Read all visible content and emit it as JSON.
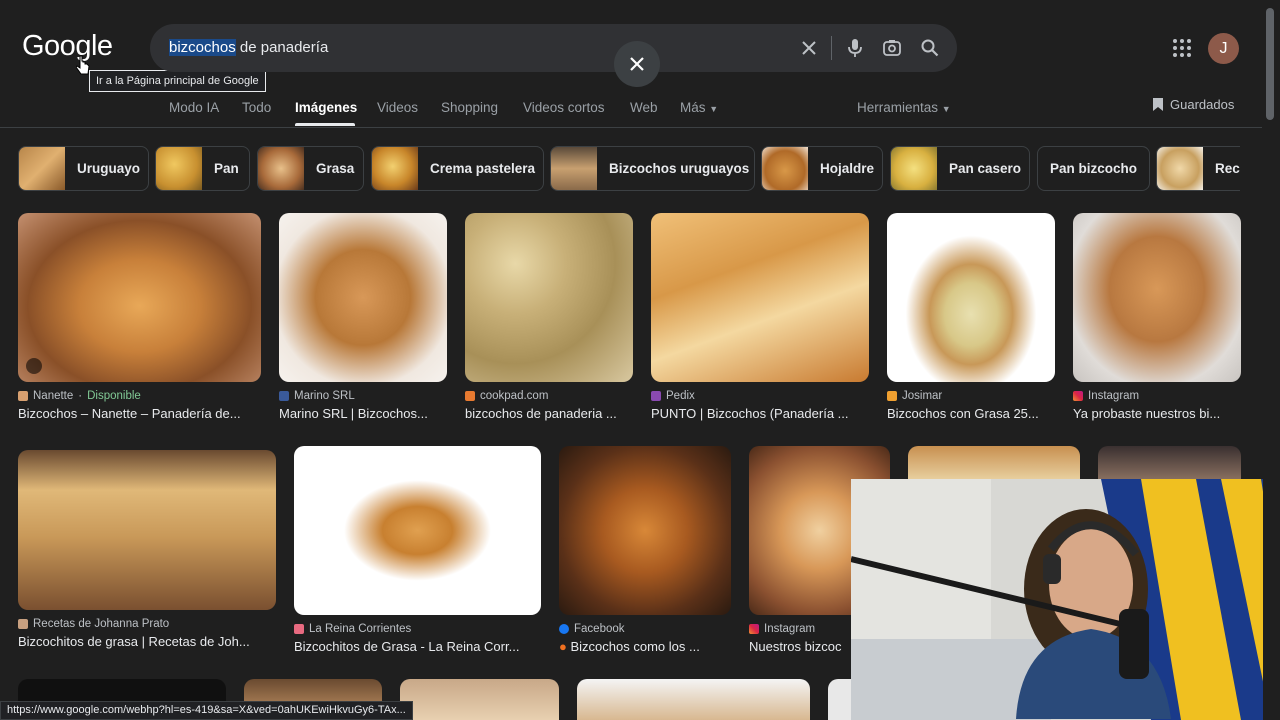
{
  "header": {
    "logo": "Google",
    "tooltip": "Ir a la Página principal de Google",
    "search_query_selected": "bizcochos",
    "search_query_rest": " de panadería",
    "avatar_letter": "J"
  },
  "tabs": [
    {
      "label": "Modo IA"
    },
    {
      "label": "Todo"
    },
    {
      "label": "Imágenes"
    },
    {
      "label": "Videos"
    },
    {
      "label": "Shopping"
    },
    {
      "label": "Videos cortos"
    },
    {
      "label": "Web"
    },
    {
      "label": "Más"
    }
  ],
  "tools_label": "Herramientas",
  "saved_label": "Guardados",
  "chips": [
    {
      "label": "Uruguayo"
    },
    {
      "label": "Pan"
    },
    {
      "label": "Grasa"
    },
    {
      "label": "Crema pastelera"
    },
    {
      "label": "Bizcochos uruguayos"
    },
    {
      "label": "Hojaldre"
    },
    {
      "label": "Pan casero"
    },
    {
      "label": "Pan bizcocho"
    },
    {
      "label": "Rece"
    }
  ],
  "results_row1": [
    {
      "source": "Nanette",
      "availability": "Disponible",
      "title": "Bizcochos – Nanette – Panadería de..."
    },
    {
      "source": "Marino SRL",
      "title": "Marino SRL | Bizcochos..."
    },
    {
      "source": "cookpad.com",
      "title": "bizcochos de panaderia ..."
    },
    {
      "source": "Pedix",
      "title": "PUNTO | Bizcochos (Panadería ..."
    },
    {
      "source": "Josimar",
      "title": "Bizcochos con Grasa 25..."
    },
    {
      "source": "Instagram",
      "title": "Ya probaste nuestros bi..."
    }
  ],
  "results_row2": [
    {
      "source": "Recetas de Johanna Prato",
      "title": "Bizcochitos de grasa | Recetas de Joh..."
    },
    {
      "source": "La Reina Corrientes",
      "title": "Bizcochitos de Grasa - La Reina Corr..."
    },
    {
      "source": "Facebook",
      "title": "Bizcochos como los ..."
    },
    {
      "source": "Instagram",
      "title": "Nuestros bizcoc"
    }
  ],
  "status_url": "https://www.google.com/webhp?hl=es-419&sa=X&ved=0ahUKEwiHkvuGy6-TAx..."
}
